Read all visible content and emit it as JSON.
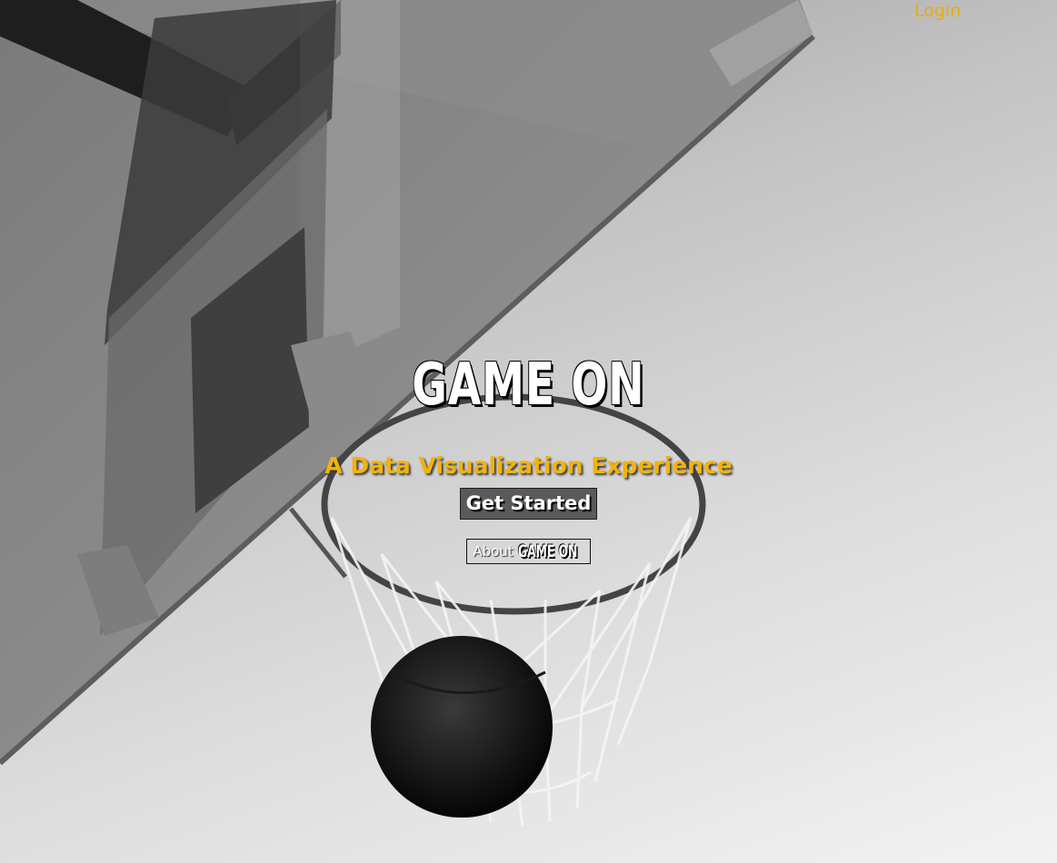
{
  "header": {
    "login_label": "Login"
  },
  "hero": {
    "logo_text": "GAME ON",
    "tagline": "A Data Visualization Experience",
    "get_started_label": "Get Started",
    "about_label": "About",
    "about_logo_text": "GAME ON"
  },
  "colors": {
    "accent": "#f2b30b",
    "login": "#e8ad0c",
    "button_bg": "#5a5a5a"
  },
  "background": {
    "scene": "basketball-hoop-photo",
    "tone": "grayscale"
  }
}
